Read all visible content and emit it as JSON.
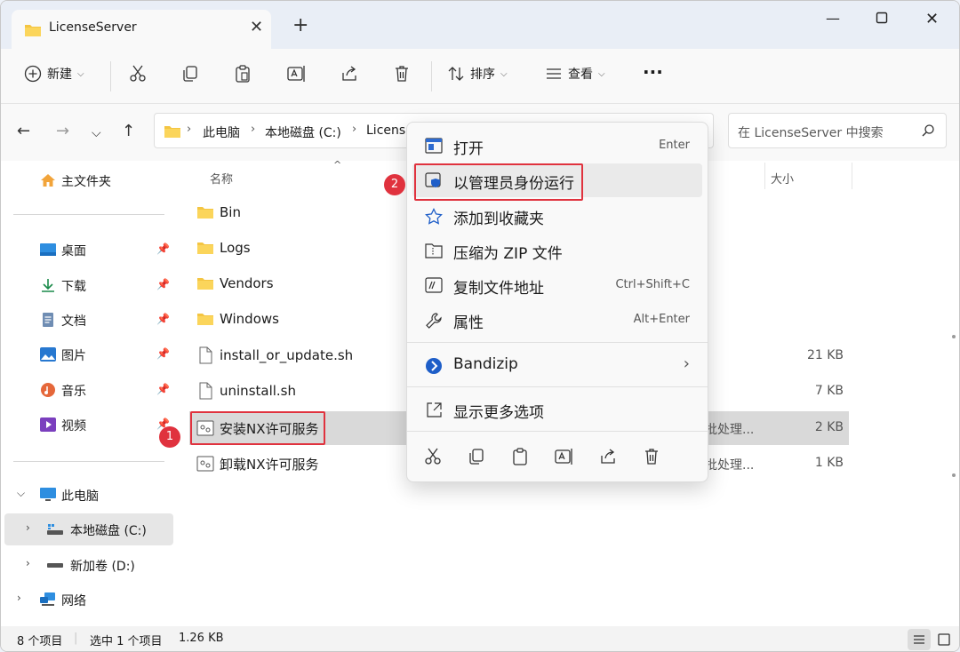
{
  "tab": {
    "title": "LicenseServer"
  },
  "toolbar": {
    "new_label": "新建",
    "sort_label": "排序",
    "view_label": "查看"
  },
  "address": {
    "crumbs": [
      "此电脑",
      "本地磁盘 (C:)",
      "Licens"
    ],
    "search_placeholder": "在 LicenseServer 中搜索"
  },
  "sidebar": {
    "home": "主文件夹",
    "quick": [
      {
        "label": "桌面"
      },
      {
        "label": "下载"
      },
      {
        "label": "文档"
      },
      {
        "label": "图片"
      },
      {
        "label": "音乐"
      },
      {
        "label": "视频"
      }
    ],
    "thispc": "此电脑",
    "drive_c": "本地磁盘 (C:)",
    "drive_d": "新加卷 (D:)",
    "network": "网络"
  },
  "columns": {
    "name": "名称",
    "size": "大小"
  },
  "files": [
    {
      "name": "Bin",
      "type": "",
      "size": ""
    },
    {
      "name": "Logs",
      "type": "",
      "size": ""
    },
    {
      "name": "Vendors",
      "type": "",
      "size": ""
    },
    {
      "name": "Windows",
      "type": "",
      "size": ""
    },
    {
      "name": "install_or_update.sh",
      "type": "",
      "size": "21 KB"
    },
    {
      "name": "uninstall.sh",
      "type": "",
      "size": "7 KB"
    },
    {
      "name": "安装NX许可服务",
      "type": "批处理...",
      "size": "2 KB"
    },
    {
      "name": "卸载NX许可服务",
      "type": "批处理...",
      "size": "1 KB"
    }
  ],
  "annotations": {
    "step1": "1",
    "step2": "2"
  },
  "context_menu": {
    "open": {
      "label": "打开",
      "shortcut": "Enter"
    },
    "run_as_admin": {
      "label": "以管理员身份运行"
    },
    "favorite": {
      "label": "添加到收藏夹"
    },
    "zip": {
      "label": "压缩为 ZIP 文件"
    },
    "copy_path": {
      "label": "复制文件地址",
      "shortcut": "Ctrl+Shift+C"
    },
    "properties": {
      "label": "属性",
      "shortcut": "Alt+Enter"
    },
    "bandizip": {
      "label": "Bandizip"
    },
    "more": {
      "label": "显示更多选项"
    }
  },
  "status": {
    "count": "8 个项目",
    "selected": "选中 1 个项目",
    "size": "1.26 KB"
  },
  "colors": {
    "accent": "#0067c0",
    "annotation_red": "#e0323e",
    "folder": "#f4c542"
  }
}
